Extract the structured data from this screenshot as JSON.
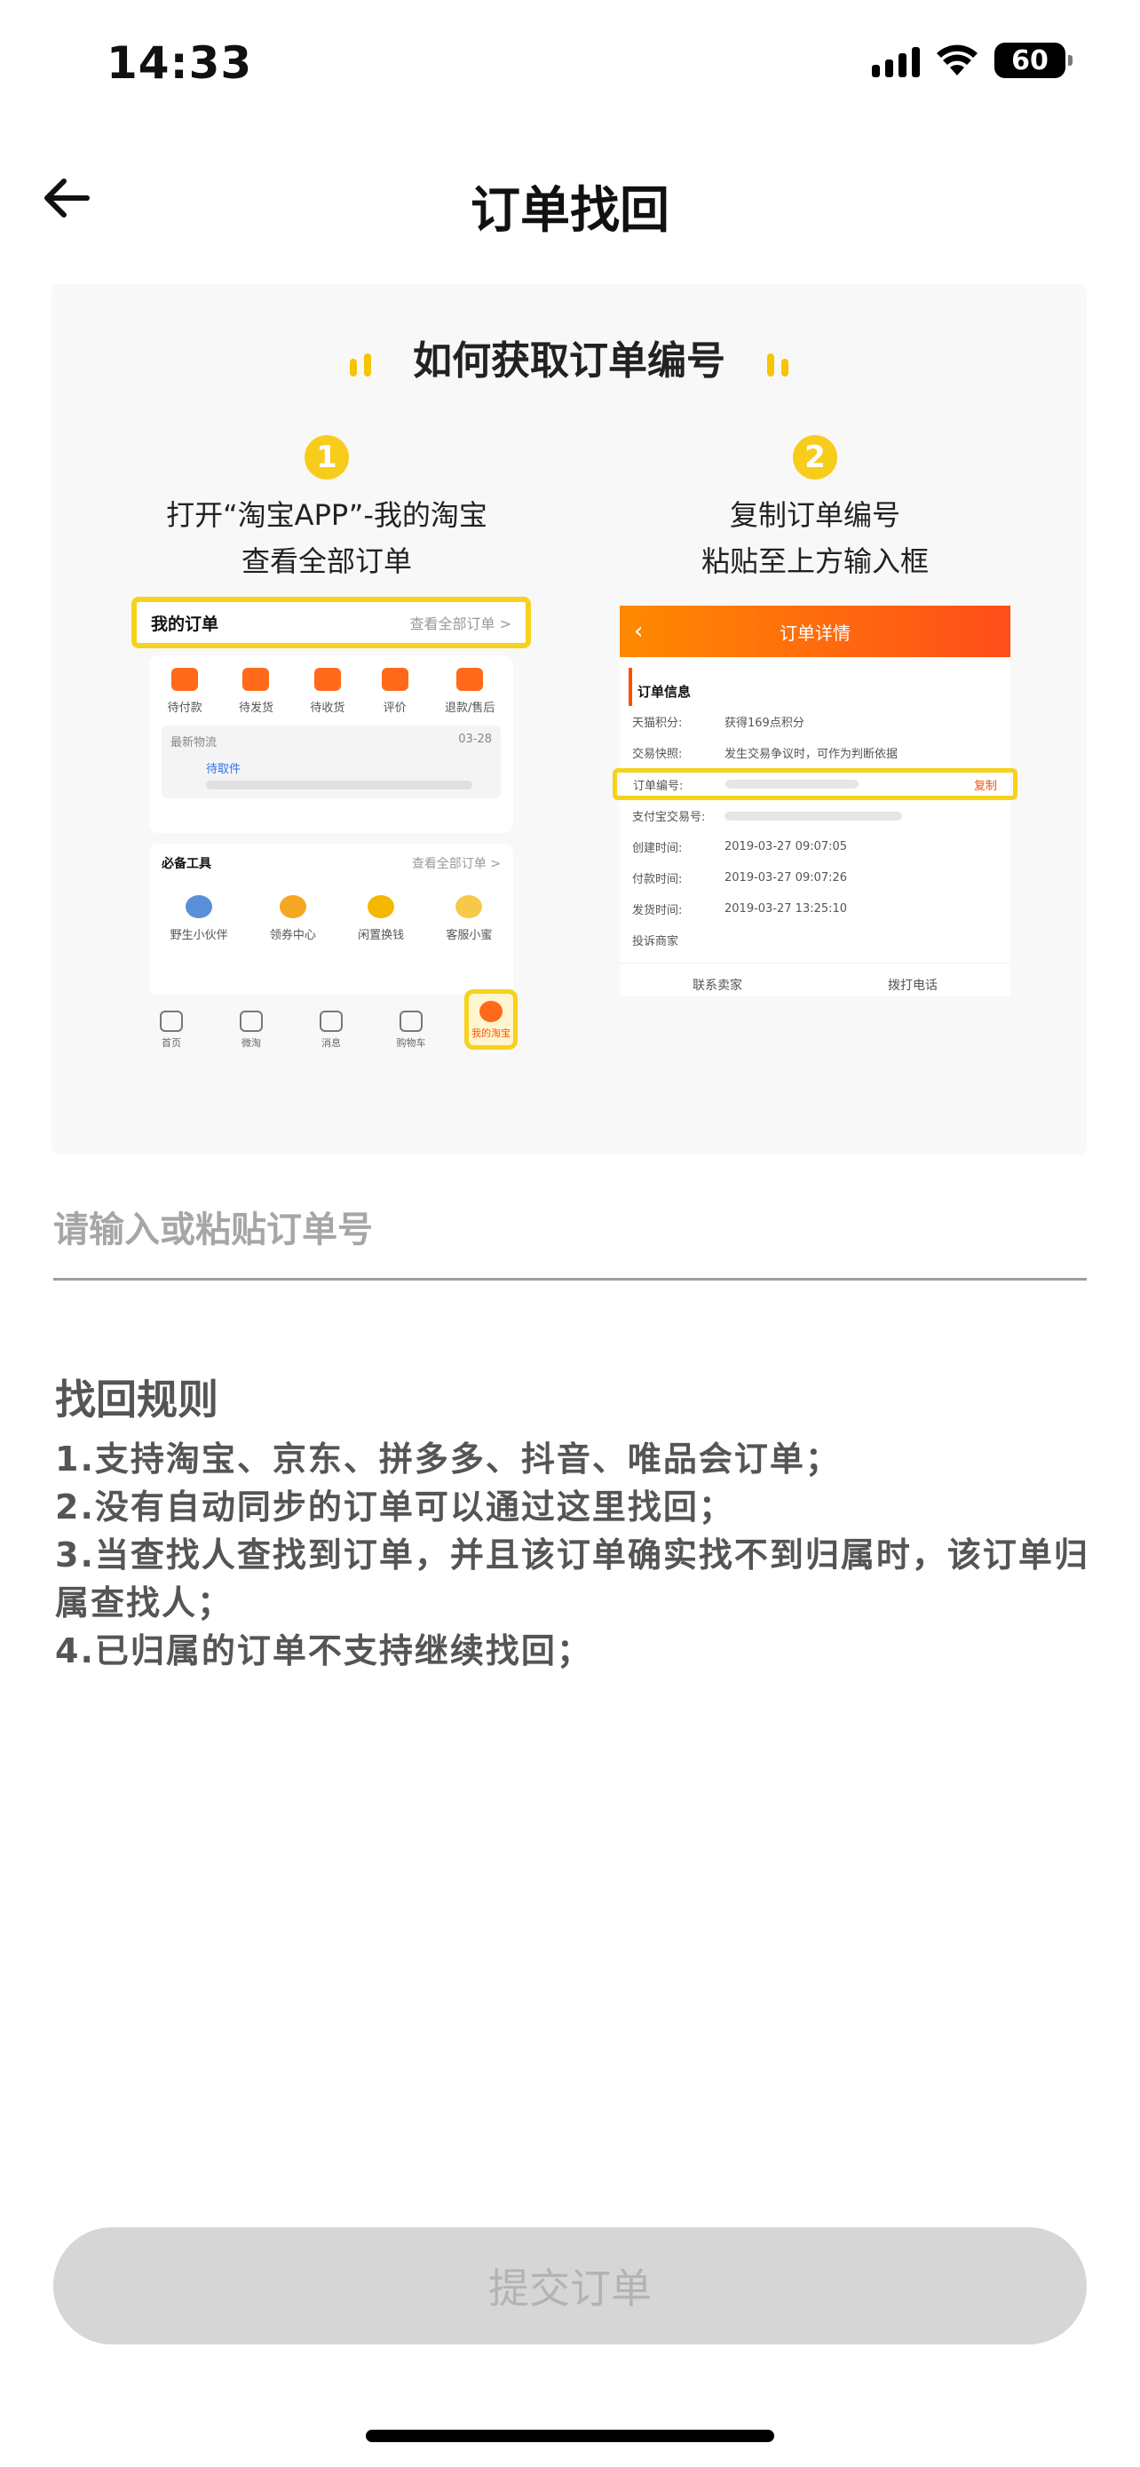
{
  "status_bar": {
    "time": "14:33",
    "battery": "60"
  },
  "nav": {
    "title": "订单找回"
  },
  "guide": {
    "heading": "如何获取订单编号",
    "steps": [
      {
        "number": "1",
        "line1": "打开“淘宝APP”-我的淘宝",
        "line2": "查看全部订单"
      },
      {
        "number": "2",
        "line1": "复制订单编号",
        "line2": "粘贴至上方输入框"
      }
    ],
    "mock1": {
      "header_title": "我的订单",
      "header_link": "查看全部订单 >",
      "order_icons": [
        "待付款",
        "待发货",
        "待收货",
        "评价",
        "退款/售后"
      ],
      "logistics_label": "最新物流",
      "logistics_date": "03-28",
      "logistics_status": "待取件",
      "tools_title": "必备工具",
      "tools_link": "查看全部订单 >",
      "tools": [
        "野生小伙伴",
        "领券中心",
        "闲置换钱",
        "客服小蜜"
      ],
      "tabs": [
        "首页",
        "微淘",
        "消息",
        "购物车",
        "我的淘宝"
      ]
    },
    "mock2": {
      "title": "订单详情",
      "section": "订单信息",
      "rows": [
        {
          "k": "天猫积分:",
          "v": "获得169点积分"
        },
        {
          "k": "交易快照:",
          "v": "发生交易争议时，可作为判断依据"
        },
        {
          "k": "订单编号:",
          "v": ""
        },
        {
          "k": "支付宝交易号:",
          "v": ""
        },
        {
          "k": "创建时间:",
          "v": "2019-03-27 09:07:05"
        },
        {
          "k": "付款时间:",
          "v": "2019-03-27 09:07:26"
        },
        {
          "k": "发货时间:",
          "v": "2019-03-27 13:25:10"
        },
        {
          "k": "投诉商家",
          "v": ""
        }
      ],
      "copy_label": "复制",
      "contact_seller": "联系卖家",
      "call_phone": "拨打电话"
    }
  },
  "input": {
    "placeholder": "请输入或粘贴订单号",
    "value": ""
  },
  "rules": {
    "title": "找回规则",
    "items": [
      " 1.支持淘宝、京东、拼多多、抖音、唯品会订单；",
      " 2.没有自动同步的订单可以通过这里找回；",
      " 3.当查找人查找到订单，并且该订单确实找不到归属时，该订单归属查找人；",
      " 4.已归属的订单不支持继续找回；"
    ]
  },
  "submit": {
    "label": "提交订单"
  }
}
